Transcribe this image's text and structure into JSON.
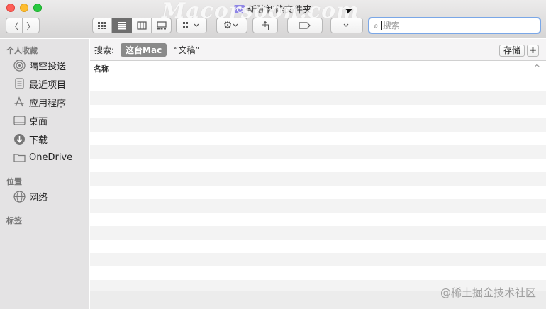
{
  "window": {
    "title": "新建智能文件夹",
    "watermark_top": "Macorsoon.com"
  },
  "toolbar": {
    "back_label": "〈",
    "forward_label": "〉",
    "search_placeholder": "搜索"
  },
  "sidebar": {
    "favorites_header": "个人收藏",
    "favorites": [
      {
        "label": "隔空投送",
        "icon": "airdrop-icon"
      },
      {
        "label": "最近项目",
        "icon": "recents-icon"
      },
      {
        "label": "应用程序",
        "icon": "applications-icon"
      },
      {
        "label": "桌面",
        "icon": "desktop-icon"
      },
      {
        "label": "下载",
        "icon": "downloads-icon"
      },
      {
        "label": "OneDrive",
        "icon": "folder-icon"
      }
    ],
    "locations_header": "位置",
    "locations": [
      {
        "label": "网络",
        "icon": "network-icon"
      }
    ],
    "tags_header": "标签"
  },
  "scope_bar": {
    "label": "搜索:",
    "active_scope": "这台Mac",
    "other_scope": "“文稿”",
    "save_label": "存储",
    "add_label": "+"
  },
  "list": {
    "column_name": "名称",
    "sort_indicator": "^"
  },
  "watermark_bottom": "@稀土掘金技术社区",
  "colors": {
    "accent": "#7aa7e7",
    "sidebar_bg": "#e4e3e4",
    "scope_active": "#8a8a8a"
  }
}
